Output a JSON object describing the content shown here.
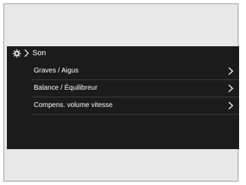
{
  "header": {
    "icon": "gear-icon",
    "breadcrumb_icon": "chevron-right-icon",
    "title": "Son"
  },
  "menu": {
    "items": [
      {
        "label": "Graves / Aigus",
        "icon": "chevron-right-icon"
      },
      {
        "label": "Balance / Équilibreur",
        "icon": "chevron-right-icon"
      },
      {
        "label": "Compens. volume vitesse",
        "icon": "chevron-right-icon"
      }
    ]
  },
  "colors": {
    "screen_bg": "#1b1b1b",
    "text": "#ffffff",
    "divider": "#3d3d3d",
    "frame_bg": "#e8e8e8"
  }
}
